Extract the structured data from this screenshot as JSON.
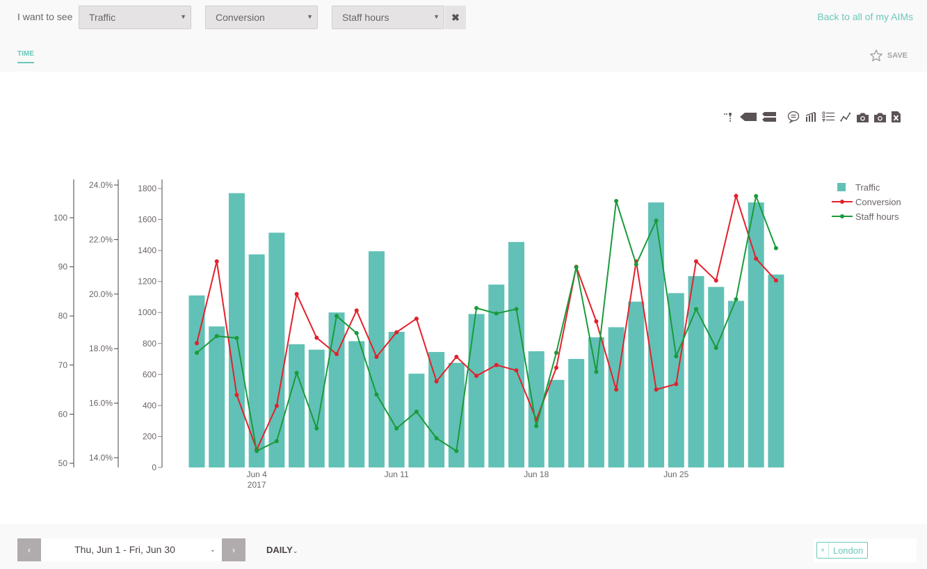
{
  "header": {
    "want_label": "I want to see",
    "selects": [
      {
        "value": "Traffic"
      },
      {
        "value": "Conversion"
      },
      {
        "value": "Staff hours"
      }
    ],
    "remove_icon": "✖",
    "back_link": "Back to all of my AIMs",
    "tab_time": "TIME",
    "save_label": "SAVE"
  },
  "toolbar": {
    "icons": [
      "annotate-point-icon",
      "tag-left-icon",
      "tag-stack-icon",
      "comment-icon",
      "bar-chart-icon",
      "list-icon",
      "line-chart-icon",
      "camera-icon",
      "camera-alt-icon",
      "excel-export-icon"
    ]
  },
  "colors": {
    "accent": "#6cc7ba",
    "bar": "#61c1b6",
    "conversion": "#e3202c",
    "staff_hours": "#1a9a3a"
  },
  "chart_data": {
    "type": "bar",
    "title": "",
    "x": [
      "Jun 1",
      "Jun 2",
      "Jun 3",
      "Jun 4",
      "Jun 5",
      "Jun 6",
      "Jun 7",
      "Jun 8",
      "Jun 9",
      "Jun 10",
      "Jun 11",
      "Jun 12",
      "Jun 13",
      "Jun 14",
      "Jun 15",
      "Jun 16",
      "Jun 17",
      "Jun 18",
      "Jun 19",
      "Jun 20",
      "Jun 21",
      "Jun 22",
      "Jun 23",
      "Jun 24",
      "Jun 25",
      "Jun 26",
      "Jun 27",
      "Jun 28",
      "Jun 29",
      "Jun 30"
    ],
    "x_tick_labels": [
      {
        "index": 3,
        "label": "Jun 4",
        "sublabel": "2017"
      },
      {
        "index": 10,
        "label": "Jun 11",
        "sublabel": ""
      },
      {
        "index": 17,
        "label": "Jun 18",
        "sublabel": ""
      },
      {
        "index": 24,
        "label": "Jun 25",
        "sublabel": ""
      }
    ],
    "series": [
      {
        "name": "Traffic",
        "type": "bar",
        "axis": "traffic",
        "values": [
          1110,
          910,
          1770,
          1375,
          1515,
          795,
          760,
          1000,
          815,
          1395,
          875,
          605,
          745,
          675,
          990,
          1180,
          1455,
          750,
          565,
          700,
          840,
          905,
          1070,
          1710,
          1125,
          1235,
          1165,
          1075,
          1710,
          1245
        ]
      },
      {
        "name": "Conversion",
        "type": "line",
        "axis": "conversion",
        "unit": "%",
        "values": [
          18.2,
          21.2,
          16.3,
          14.3,
          15.9,
          20.0,
          18.4,
          17.8,
          19.4,
          17.7,
          18.6,
          19.1,
          16.8,
          17.7,
          17.0,
          17.4,
          17.2,
          15.4,
          17.3,
          21.0,
          19.0,
          16.5,
          21.2,
          16.5,
          16.7,
          21.2,
          20.5,
          23.6,
          21.3,
          20.5
        ]
      },
      {
        "name": "Staff hours",
        "type": "line",
        "axis": "staff",
        "values": [
          72.5,
          75.9,
          75.5,
          52.5,
          54.5,
          68.4,
          57.1,
          80.0,
          76.5,
          64.0,
          57.1,
          60.5,
          55.1,
          52.5,
          81.6,
          80.5,
          81.4,
          57.6,
          72.5,
          89.9,
          68.6,
          103.4,
          90.5,
          99.4,
          71.8,
          81.4,
          73.5,
          83.4,
          104.4,
          93.8
        ]
      }
    ],
    "axes": {
      "staff": {
        "ticks": [
          50,
          60,
          70,
          80,
          90,
          100
        ],
        "tick_labels": [
          "50",
          "60",
          "70",
          "80",
          "90",
          "100"
        ],
        "range": [
          49,
          107.5
        ]
      },
      "conversion": {
        "ticks": [
          14,
          16,
          18,
          20,
          22,
          24
        ],
        "tick_labels": [
          "14.0%",
          "16.0%",
          "18.0%",
          "20.0%",
          "22.0%",
          "24.0%"
        ],
        "range": [
          13.8,
          24.2
        ]
      },
      "traffic": {
        "ticks": [
          0,
          200,
          400,
          600,
          800,
          1000,
          1200,
          1400,
          1600,
          1800
        ],
        "tick_labels": [
          "0",
          "200",
          "400",
          "600",
          "800",
          "1000",
          "1200",
          "1400",
          "1600",
          "1800"
        ],
        "range": [
          0,
          1850
        ]
      }
    },
    "legend": {
      "position": "top-right",
      "entries": [
        "Traffic",
        "Conversion",
        "Staff hours"
      ]
    },
    "grid": false,
    "xlabel": "",
    "ylabel": ""
  },
  "footer": {
    "prev_label": "‹",
    "next_label": "›",
    "date_range": "Thu, Jun 1 - Fri, Jun 30",
    "date_chevron": "⌄",
    "granularity": "DAILY",
    "granularity_chevron": "⌄",
    "location_remove": "×",
    "location": "London"
  }
}
